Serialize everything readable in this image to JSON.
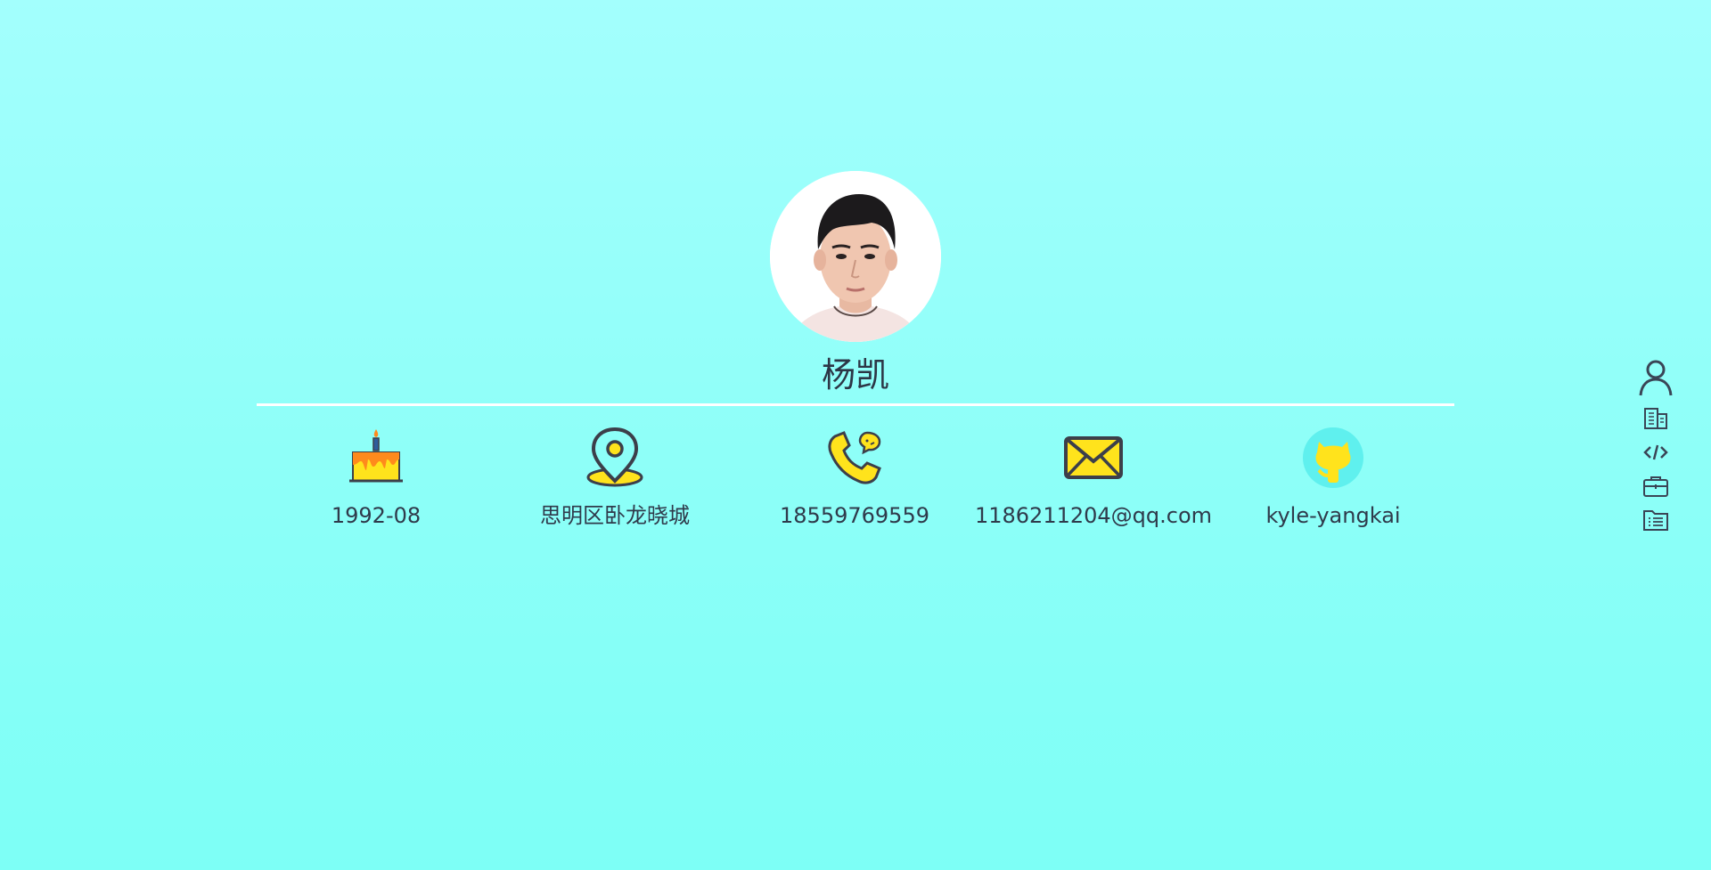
{
  "profile": {
    "name": "杨凯",
    "avatar_icon": "portrait-photo"
  },
  "info": [
    {
      "icon": "birthday-cake-icon",
      "label": "1992-08"
    },
    {
      "icon": "location-pin-icon",
      "label": "思明区卧龙晓城"
    },
    {
      "icon": "phone-icon",
      "label": "18559769559"
    },
    {
      "icon": "mail-icon",
      "label": "1186211204@qq.com"
    },
    {
      "icon": "github-octocat-icon",
      "label": "kyle-yangkai"
    }
  ],
  "side_nav": [
    {
      "icon": "user-icon"
    },
    {
      "icon": "building-icon"
    },
    {
      "icon": "code-icon"
    },
    {
      "icon": "briefcase-icon"
    },
    {
      "icon": "folder-list-icon"
    }
  ],
  "colors": {
    "background_top": "#a3fffd",
    "background_bottom": "#7dfff6",
    "text": "#333e4f",
    "icon_yellow": "#ffe31c",
    "icon_orange": "#ff8a1c",
    "icon_stroke": "#3c3f4a"
  }
}
